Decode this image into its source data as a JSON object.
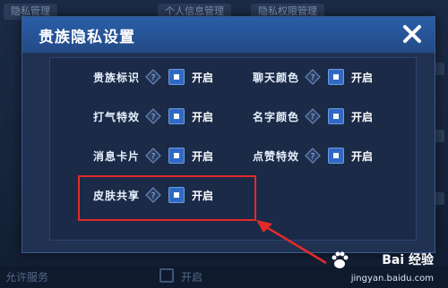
{
  "background": {
    "tabs": [
      "隐私管理",
      "个人信息管理",
      "隐私权限管理"
    ],
    "footer_label": "允许服务",
    "footer_status": "开启"
  },
  "dialog": {
    "title": "贵族隐私设置",
    "close_icon": "close-x-icon",
    "settings": [
      {
        "label": "贵族标识",
        "status": "开启"
      },
      {
        "label": "聊天颜色",
        "status": "开启"
      },
      {
        "label": "打气特效",
        "status": "开启"
      },
      {
        "label": "名字颜色",
        "status": "开启"
      },
      {
        "label": "消息卡片",
        "status": "开启"
      },
      {
        "label": "点赞特效",
        "status": "开启"
      },
      {
        "label": "皮肤共享",
        "status": "开启"
      }
    ]
  },
  "annotation": {
    "highlight_color": "#e52a2a"
  },
  "watermark": {
    "brand": "Bai 经验",
    "url": "jingyan.baidu.com"
  },
  "colors": {
    "header": "#2a5ea8",
    "toggle_on": "#2f69c4",
    "panel": "#1a2a47"
  }
}
